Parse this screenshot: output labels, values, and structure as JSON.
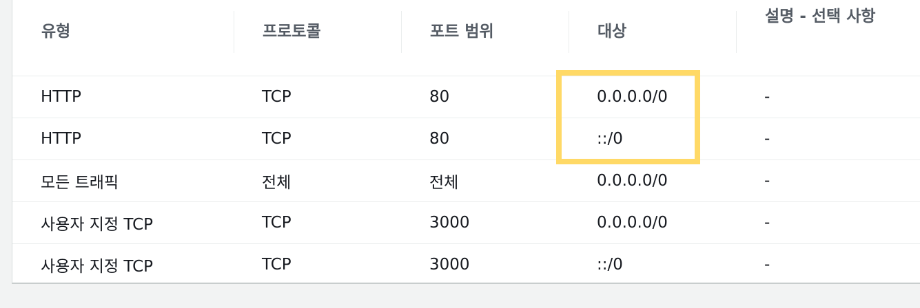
{
  "table": {
    "headers": [
      "유형",
      "프로토콜",
      "포트 범위",
      "대상",
      "설명 - 선택 사항"
    ],
    "rows": [
      [
        "HTTP",
        "TCP",
        "80",
        "0.0.0.0/0",
        "-"
      ],
      [
        "HTTP",
        "TCP",
        "80",
        "::/0",
        "-"
      ],
      [
        "모든 트래픽",
        "전체",
        "전체",
        "0.0.0.0/0",
        "-"
      ],
      [
        "사용자 지정 TCP",
        "TCP",
        "3000",
        "0.0.0.0/0",
        "-"
      ],
      [
        "사용자 지정 TCP",
        "TCP",
        "3000",
        "::/0",
        "-"
      ]
    ]
  },
  "colors": {
    "highlight": "#ffd966",
    "header_text": "#545b64",
    "body_text": "#16191f",
    "page_background": "#f2f3f3"
  }
}
